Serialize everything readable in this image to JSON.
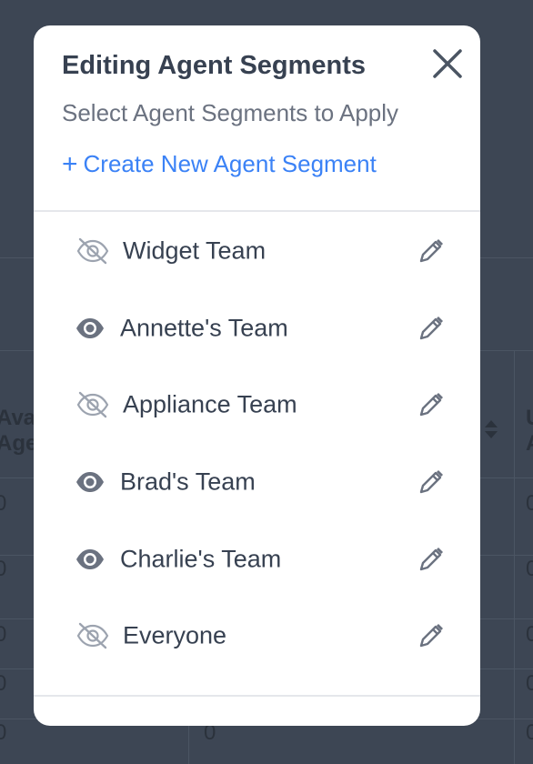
{
  "modal": {
    "title": "Editing Agent Segments",
    "subtitle": "Select Agent Segments to Apply",
    "create_plus": "+",
    "create_label": "Create New Agent Segment"
  },
  "segments": [
    {
      "label": "Widget Team",
      "visible": false,
      "icon": "eye-slash-icon"
    },
    {
      "label": "Annette's Team",
      "visible": true,
      "icon": "eye-icon"
    },
    {
      "label": "Appliance Team",
      "visible": false,
      "icon": "eye-slash-icon"
    },
    {
      "label": "Brad's Team",
      "visible": true,
      "icon": "eye-icon"
    },
    {
      "label": "Charlie's Team",
      "visible": true,
      "icon": "eye-icon"
    },
    {
      "label": "Everyone",
      "visible": false,
      "icon": "eye-slash-icon"
    }
  ],
  "background_table": {
    "header_partial_1": "Ava",
    "header_partial_2": "Age",
    "header_partial_3": "U",
    "header_partial_4": "A",
    "cell_values": [
      "0",
      "0",
      "0",
      "0",
      "0"
    ],
    "cell_center": "0",
    "right_values": [
      "0",
      "0",
      "0",
      "0",
      "0"
    ]
  },
  "colors": {
    "overlay": "#3d4654",
    "accent": "#3b82f6",
    "icon": "#6b7280"
  }
}
